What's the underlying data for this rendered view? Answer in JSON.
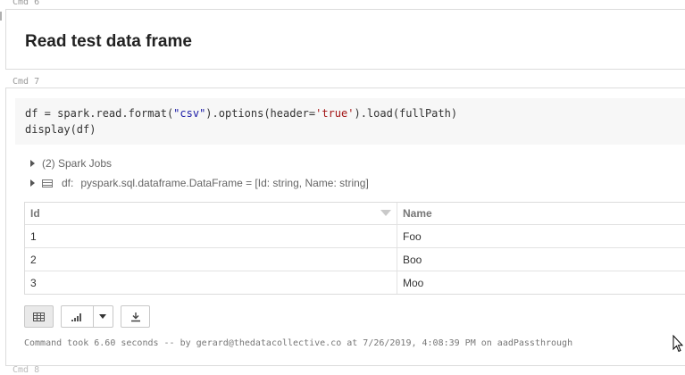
{
  "cells": {
    "cmd6": {
      "label": "Cmd 6",
      "markdown_title": "Read test data frame"
    },
    "cmd7": {
      "label": "Cmd 7",
      "code": {
        "line1_prefix": "df = spark.read.format(",
        "line1_str1": "\"csv\"",
        "line1_mid": ").options(header=",
        "line1_str2": "'true'",
        "line1_suffix": ").load(fullPath)",
        "line2": "display(df)"
      },
      "output": {
        "spark_jobs": "(2) Spark Jobs",
        "df_label": "df:",
        "df_schema": "pyspark.sql.dataframe.DataFrame = [Id: string, Name: string]",
        "table": {
          "columns": [
            "Id",
            "Name"
          ],
          "rows": [
            [
              "1",
              "Foo"
            ],
            [
              "2",
              "Boo"
            ],
            [
              "3",
              "Moo"
            ]
          ]
        },
        "toolbar": {
          "table_icon": "table-icon",
          "chart_icon": "bar-chart-icon",
          "dropdown_icon": "chevron-down-icon",
          "download_icon": "download-icon"
        },
        "status": "Command took 6.60 seconds -- by gerard@thedatacollective.co at 7/26/2019, 4:08:39 PM on aadPassthrough"
      }
    },
    "cmd8": {
      "label": "Cmd 8"
    }
  }
}
